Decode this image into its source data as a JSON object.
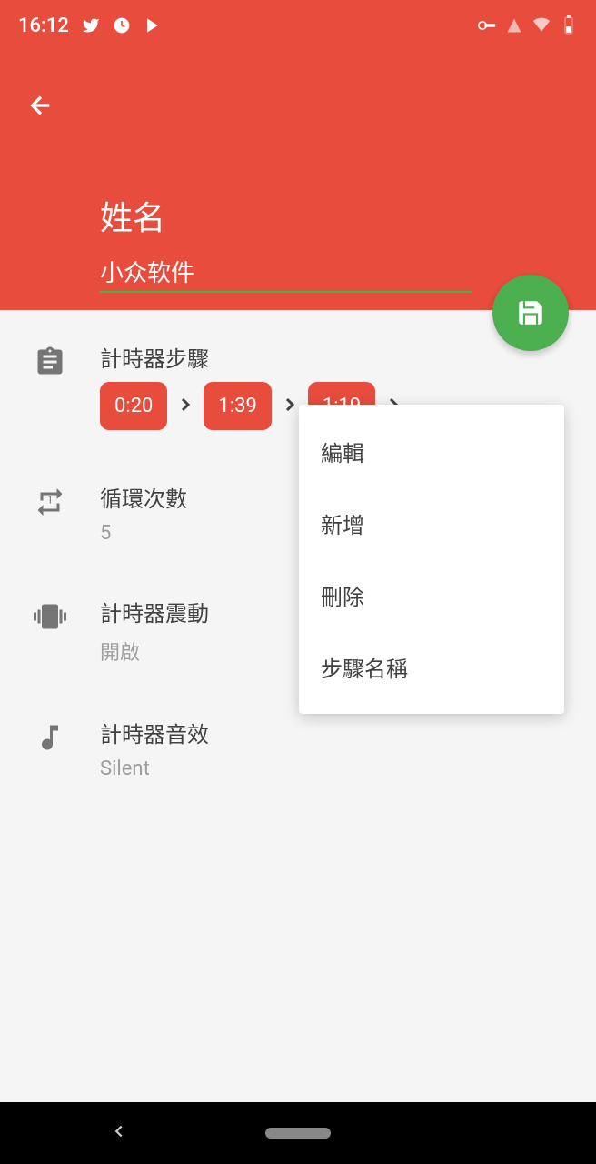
{
  "statusBar": {
    "time": "16:12"
  },
  "header": {
    "nameLabel": "姓名",
    "nameValue": "小众软件"
  },
  "timerSteps": {
    "label": "計時器步驟",
    "steps": [
      "0:20",
      "1:39",
      "1:19"
    ]
  },
  "loopCount": {
    "label": "循環次數",
    "value": "5"
  },
  "vibration": {
    "label": "計時器震動",
    "value": "開啟"
  },
  "sound": {
    "label": "計時器音效",
    "value": "Silent"
  },
  "menu": {
    "edit": "編輯",
    "add": "新增",
    "delete": "刪除",
    "stepName": "步驟名稱"
  }
}
